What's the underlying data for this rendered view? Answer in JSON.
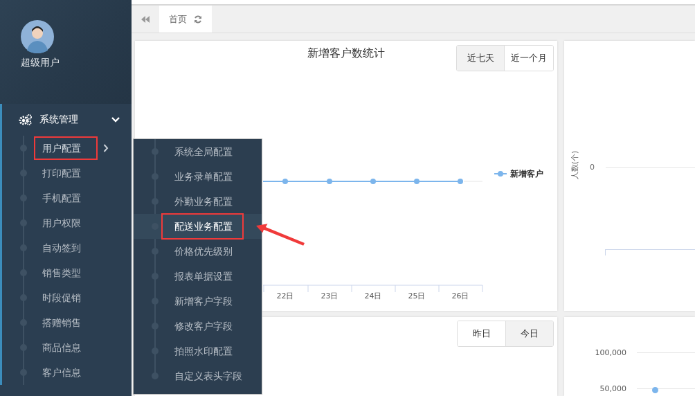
{
  "user": {
    "name": "超级用户"
  },
  "sidebar": {
    "group": {
      "label": "系统管理",
      "expanded": true
    },
    "items": [
      {
        "label": "用户配置",
        "selected": true,
        "has_submenu": true,
        "annotated": true
      },
      {
        "label": "打印配置",
        "selected": false,
        "has_submenu": false,
        "annotated": false
      },
      {
        "label": "手机配置",
        "selected": false,
        "has_submenu": false,
        "annotated": false
      },
      {
        "label": "用户权限",
        "selected": false,
        "has_submenu": false,
        "annotated": false
      },
      {
        "label": "自动签到",
        "selected": false,
        "has_submenu": false,
        "annotated": false
      },
      {
        "label": "销售类型",
        "selected": false,
        "has_submenu": false,
        "annotated": false
      },
      {
        "label": "时段促销",
        "selected": false,
        "has_submenu": false,
        "annotated": false
      },
      {
        "label": "搭赠销售",
        "selected": false,
        "has_submenu": false,
        "annotated": false
      },
      {
        "label": "商品信息",
        "selected": false,
        "has_submenu": false,
        "annotated": false
      },
      {
        "label": "客户信息",
        "selected": false,
        "has_submenu": false,
        "annotated": false
      }
    ]
  },
  "submenu": {
    "items": [
      {
        "label": "系统全局配置",
        "selected": false,
        "annotated": false
      },
      {
        "label": "业务录单配置",
        "selected": false,
        "annotated": false
      },
      {
        "label": "外勤业务配置",
        "selected": false,
        "annotated": false
      },
      {
        "label": "配送业务配置",
        "selected": true,
        "annotated": true
      },
      {
        "label": "价格优先级别",
        "selected": false,
        "annotated": false
      },
      {
        "label": "报表单据设置",
        "selected": false,
        "annotated": false
      },
      {
        "label": "新增客户字段",
        "selected": false,
        "annotated": false
      },
      {
        "label": "修改客户字段",
        "selected": false,
        "annotated": false
      },
      {
        "label": "拍照水印配置",
        "selected": false,
        "annotated": false
      },
      {
        "label": "自定义表头字段",
        "selected": false,
        "annotated": false
      }
    ]
  },
  "tabs": [
    {
      "label": "首页",
      "selected": true
    }
  ],
  "customer_chart": {
    "title": "新增客户数统计",
    "ranges": [
      {
        "label": "近七天",
        "selected": true
      },
      {
        "label": "近一个月",
        "selected": false
      }
    ],
    "x_labels": [
      "22日",
      "23日",
      "24日",
      "25日",
      "26日"
    ],
    "legend": "新增客户"
  },
  "people_chart": {
    "ylabel": "人数(个)",
    "yticks": [
      "0"
    ]
  },
  "daily_panel": {
    "ranges": [
      {
        "label": "昨日",
        "selected": false
      },
      {
        "label": "今日",
        "selected": true
      }
    ]
  },
  "amount_chart": {
    "yticks": [
      "100,000",
      "50,000"
    ]
  }
}
